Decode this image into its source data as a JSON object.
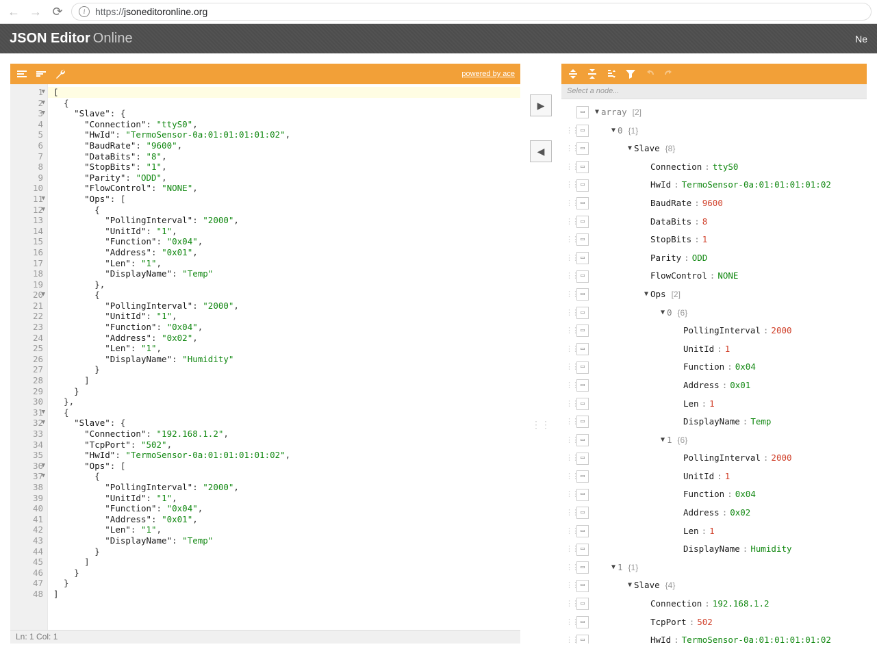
{
  "browser": {
    "url_scheme": "https://",
    "url_domain": "jsoneditoronline.org"
  },
  "header": {
    "logo_bold": "JSON Editor",
    "logo_light": "Online",
    "menu_right": "Ne"
  },
  "left_panel": {
    "powered": "powered by ace",
    "status": "Ln: 1   Col: 1",
    "code_lines": [
      {
        "n": 1,
        "fold": true,
        "tokens": [
          [
            "punc",
            "["
          ]
        ]
      },
      {
        "n": 2,
        "fold": true,
        "tokens": [
          [
            "punc",
            "  {"
          ]
        ]
      },
      {
        "n": 3,
        "fold": true,
        "tokens": [
          [
            "punc",
            "    "
          ],
          [
            "key",
            "\"Slave\""
          ],
          [
            "punc",
            ": {"
          ]
        ]
      },
      {
        "n": 4,
        "tokens": [
          [
            "punc",
            "      "
          ],
          [
            "key",
            "\"Connection\""
          ],
          [
            "punc",
            ": "
          ],
          [
            "str",
            "\"ttyS0\""
          ],
          [
            "punc",
            ","
          ]
        ]
      },
      {
        "n": 5,
        "tokens": [
          [
            "punc",
            "      "
          ],
          [
            "key",
            "\"HwId\""
          ],
          [
            "punc",
            ": "
          ],
          [
            "str",
            "\"TermoSensor-0a:01:01:01:01:02\""
          ],
          [
            "punc",
            ","
          ]
        ]
      },
      {
        "n": 6,
        "tokens": [
          [
            "punc",
            "      "
          ],
          [
            "key",
            "\"BaudRate\""
          ],
          [
            "punc",
            ": "
          ],
          [
            "str",
            "\"9600\""
          ],
          [
            "punc",
            ","
          ]
        ]
      },
      {
        "n": 7,
        "tokens": [
          [
            "punc",
            "      "
          ],
          [
            "key",
            "\"DataBits\""
          ],
          [
            "punc",
            ": "
          ],
          [
            "str",
            "\"8\""
          ],
          [
            "punc",
            ","
          ]
        ]
      },
      {
        "n": 8,
        "tokens": [
          [
            "punc",
            "      "
          ],
          [
            "key",
            "\"StopBits\""
          ],
          [
            "punc",
            ": "
          ],
          [
            "str",
            "\"1\""
          ],
          [
            "punc",
            ","
          ]
        ]
      },
      {
        "n": 9,
        "tokens": [
          [
            "punc",
            "      "
          ],
          [
            "key",
            "\"Parity\""
          ],
          [
            "punc",
            ": "
          ],
          [
            "str",
            "\"ODD\""
          ],
          [
            "punc",
            ","
          ]
        ]
      },
      {
        "n": 10,
        "tokens": [
          [
            "punc",
            "      "
          ],
          [
            "key",
            "\"FlowControl\""
          ],
          [
            "punc",
            ": "
          ],
          [
            "str",
            "\"NONE\""
          ],
          [
            "punc",
            ","
          ]
        ]
      },
      {
        "n": 11,
        "fold": true,
        "tokens": [
          [
            "punc",
            "      "
          ],
          [
            "key",
            "\"Ops\""
          ],
          [
            "punc",
            ": ["
          ]
        ]
      },
      {
        "n": 12,
        "fold": true,
        "tokens": [
          [
            "punc",
            "        {"
          ]
        ]
      },
      {
        "n": 13,
        "tokens": [
          [
            "punc",
            "          "
          ],
          [
            "key",
            "\"PollingInterval\""
          ],
          [
            "punc",
            ": "
          ],
          [
            "str",
            "\"2000\""
          ],
          [
            "punc",
            ","
          ]
        ]
      },
      {
        "n": 14,
        "tokens": [
          [
            "punc",
            "          "
          ],
          [
            "key",
            "\"UnitId\""
          ],
          [
            "punc",
            ": "
          ],
          [
            "str",
            "\"1\""
          ],
          [
            "punc",
            ","
          ]
        ]
      },
      {
        "n": 15,
        "tokens": [
          [
            "punc",
            "          "
          ],
          [
            "key",
            "\"Function\""
          ],
          [
            "punc",
            ": "
          ],
          [
            "str",
            "\"0x04\""
          ],
          [
            "punc",
            ","
          ]
        ]
      },
      {
        "n": 16,
        "tokens": [
          [
            "punc",
            "          "
          ],
          [
            "key",
            "\"Address\""
          ],
          [
            "punc",
            ": "
          ],
          [
            "str",
            "\"0x01\""
          ],
          [
            "punc",
            ","
          ]
        ]
      },
      {
        "n": 17,
        "tokens": [
          [
            "punc",
            "          "
          ],
          [
            "key",
            "\"Len\""
          ],
          [
            "punc",
            ": "
          ],
          [
            "str",
            "\"1\""
          ],
          [
            "punc",
            ","
          ]
        ]
      },
      {
        "n": 18,
        "tokens": [
          [
            "punc",
            "          "
          ],
          [
            "key",
            "\"DisplayName\""
          ],
          [
            "punc",
            ": "
          ],
          [
            "str",
            "\"Temp\""
          ]
        ]
      },
      {
        "n": 19,
        "tokens": [
          [
            "punc",
            "        },"
          ]
        ]
      },
      {
        "n": 20,
        "fold": true,
        "tokens": [
          [
            "punc",
            "        {"
          ]
        ]
      },
      {
        "n": 21,
        "tokens": [
          [
            "punc",
            "          "
          ],
          [
            "key",
            "\"PollingInterval\""
          ],
          [
            "punc",
            ": "
          ],
          [
            "str",
            "\"2000\""
          ],
          [
            "punc",
            ","
          ]
        ]
      },
      {
        "n": 22,
        "tokens": [
          [
            "punc",
            "          "
          ],
          [
            "key",
            "\"UnitId\""
          ],
          [
            "punc",
            ": "
          ],
          [
            "str",
            "\"1\""
          ],
          [
            "punc",
            ","
          ]
        ]
      },
      {
        "n": 23,
        "tokens": [
          [
            "punc",
            "          "
          ],
          [
            "key",
            "\"Function\""
          ],
          [
            "punc",
            ": "
          ],
          [
            "str",
            "\"0x04\""
          ],
          [
            "punc",
            ","
          ]
        ]
      },
      {
        "n": 24,
        "tokens": [
          [
            "punc",
            "          "
          ],
          [
            "key",
            "\"Address\""
          ],
          [
            "punc",
            ": "
          ],
          [
            "str",
            "\"0x02\""
          ],
          [
            "punc",
            ","
          ]
        ]
      },
      {
        "n": 25,
        "tokens": [
          [
            "punc",
            "          "
          ],
          [
            "key",
            "\"Len\""
          ],
          [
            "punc",
            ": "
          ],
          [
            "str",
            "\"1\""
          ],
          [
            "punc",
            ","
          ]
        ]
      },
      {
        "n": 26,
        "tokens": [
          [
            "punc",
            "          "
          ],
          [
            "key",
            "\"DisplayName\""
          ],
          [
            "punc",
            ": "
          ],
          [
            "str",
            "\"Humidity\""
          ]
        ]
      },
      {
        "n": 27,
        "tokens": [
          [
            "punc",
            "        }"
          ]
        ]
      },
      {
        "n": 28,
        "tokens": [
          [
            "punc",
            "      ]"
          ]
        ]
      },
      {
        "n": 29,
        "tokens": [
          [
            "punc",
            "    }"
          ]
        ]
      },
      {
        "n": 30,
        "tokens": [
          [
            "punc",
            "  },"
          ]
        ]
      },
      {
        "n": 31,
        "fold": true,
        "tokens": [
          [
            "punc",
            "  {"
          ]
        ]
      },
      {
        "n": 32,
        "fold": true,
        "tokens": [
          [
            "punc",
            "    "
          ],
          [
            "key",
            "\"Slave\""
          ],
          [
            "punc",
            ": {"
          ]
        ]
      },
      {
        "n": 33,
        "tokens": [
          [
            "punc",
            "      "
          ],
          [
            "key",
            "\"Connection\""
          ],
          [
            "punc",
            ": "
          ],
          [
            "str",
            "\"192.168.1.2\""
          ],
          [
            "punc",
            ","
          ]
        ]
      },
      {
        "n": 34,
        "tokens": [
          [
            "punc",
            "      "
          ],
          [
            "key",
            "\"TcpPort\""
          ],
          [
            "punc",
            ": "
          ],
          [
            "str",
            "\"502\""
          ],
          [
            "punc",
            ","
          ]
        ]
      },
      {
        "n": 35,
        "tokens": [
          [
            "punc",
            "      "
          ],
          [
            "key",
            "\"HwId\""
          ],
          [
            "punc",
            ": "
          ],
          [
            "str",
            "\"TermoSensor-0a:01:01:01:01:02\""
          ],
          [
            "punc",
            ","
          ]
        ]
      },
      {
        "n": 36,
        "fold": true,
        "tokens": [
          [
            "punc",
            "      "
          ],
          [
            "key",
            "\"Ops\""
          ],
          [
            "punc",
            ": ["
          ]
        ]
      },
      {
        "n": 37,
        "fold": true,
        "tokens": [
          [
            "punc",
            "        {"
          ]
        ]
      },
      {
        "n": 38,
        "tokens": [
          [
            "punc",
            "          "
          ],
          [
            "key",
            "\"PollingInterval\""
          ],
          [
            "punc",
            ": "
          ],
          [
            "str",
            "\"2000\""
          ],
          [
            "punc",
            ","
          ]
        ]
      },
      {
        "n": 39,
        "tokens": [
          [
            "punc",
            "          "
          ],
          [
            "key",
            "\"UnitId\""
          ],
          [
            "punc",
            ": "
          ],
          [
            "str",
            "\"1\""
          ],
          [
            "punc",
            ","
          ]
        ]
      },
      {
        "n": 40,
        "tokens": [
          [
            "punc",
            "          "
          ],
          [
            "key",
            "\"Function\""
          ],
          [
            "punc",
            ": "
          ],
          [
            "str",
            "\"0x04\""
          ],
          [
            "punc",
            ","
          ]
        ]
      },
      {
        "n": 41,
        "tokens": [
          [
            "punc",
            "          "
          ],
          [
            "key",
            "\"Address\""
          ],
          [
            "punc",
            ": "
          ],
          [
            "str",
            "\"0x01\""
          ],
          [
            "punc",
            ","
          ]
        ]
      },
      {
        "n": 42,
        "tokens": [
          [
            "punc",
            "          "
          ],
          [
            "key",
            "\"Len\""
          ],
          [
            "punc",
            ": "
          ],
          [
            "str",
            "\"1\""
          ],
          [
            "punc",
            ","
          ]
        ]
      },
      {
        "n": 43,
        "tokens": [
          [
            "punc",
            "          "
          ],
          [
            "key",
            "\"DisplayName\""
          ],
          [
            "punc",
            ": "
          ],
          [
            "str",
            "\"Temp\""
          ]
        ]
      },
      {
        "n": 44,
        "tokens": [
          [
            "punc",
            "        }"
          ]
        ]
      },
      {
        "n": 45,
        "tokens": [
          [
            "punc",
            "      ]"
          ]
        ]
      },
      {
        "n": 46,
        "tokens": [
          [
            "punc",
            "    }"
          ]
        ]
      },
      {
        "n": 47,
        "tokens": [
          [
            "punc",
            "  }"
          ]
        ]
      },
      {
        "n": 48,
        "tokens": [
          [
            "punc",
            "]"
          ]
        ]
      }
    ]
  },
  "middle": {
    "arrow_right": "▶",
    "arrow_left": "◀"
  },
  "right_panel": {
    "node_path_placeholder": "Select a node...",
    "tree_rows": [
      {
        "indent": 0,
        "nohandle": true,
        "caret": "▼",
        "key": "array",
        "count": "[2]",
        "keyGray": true
      },
      {
        "indent": 1,
        "caret": "▼",
        "key": "0",
        "count": "{1}",
        "keyGray": true
      },
      {
        "indent": 2,
        "caret": "▼",
        "key": "Slave",
        "count": "{8}"
      },
      {
        "indent": 3,
        "key": "Connection",
        "sep": ":",
        "val": "ttyS0",
        "vtype": "str"
      },
      {
        "indent": 3,
        "key": "HwId",
        "sep": ":",
        "val": "TermoSensor-0a:01:01:01:01:02",
        "vtype": "str"
      },
      {
        "indent": 3,
        "key": "BaudRate",
        "sep": ":",
        "val": "9600",
        "vtype": "num"
      },
      {
        "indent": 3,
        "key": "DataBits",
        "sep": ":",
        "val": "8",
        "vtype": "num"
      },
      {
        "indent": 3,
        "key": "StopBits",
        "sep": ":",
        "val": "1",
        "vtype": "num"
      },
      {
        "indent": 3,
        "key": "Parity",
        "sep": ":",
        "val": "ODD",
        "vtype": "str"
      },
      {
        "indent": 3,
        "key": "FlowControl",
        "sep": ":",
        "val": "NONE",
        "vtype": "str"
      },
      {
        "indent": 3,
        "caret": "▼",
        "key": "Ops",
        "count": "[2]"
      },
      {
        "indent": 4,
        "caret": "▼",
        "key": "0",
        "count": "{6}",
        "keyGray": true
      },
      {
        "indent": 5,
        "key": "PollingInterval",
        "sep": ":",
        "val": "2000",
        "vtype": "num"
      },
      {
        "indent": 5,
        "key": "UnitId",
        "sep": ":",
        "val": "1",
        "vtype": "num"
      },
      {
        "indent": 5,
        "key": "Function",
        "sep": ":",
        "val": "0x04",
        "vtype": "str"
      },
      {
        "indent": 5,
        "key": "Address",
        "sep": ":",
        "val": "0x01",
        "vtype": "str"
      },
      {
        "indent": 5,
        "key": "Len ",
        "sep": ":",
        "val": "1",
        "vtype": "num"
      },
      {
        "indent": 5,
        "key": "DisplayName",
        "sep": ":",
        "val": "Temp",
        "vtype": "str"
      },
      {
        "indent": 4,
        "caret": "▼",
        "key": "1",
        "count": "{6}",
        "keyGray": true
      },
      {
        "indent": 5,
        "key": "PollingInterval",
        "sep": ":",
        "val": "2000",
        "vtype": "num"
      },
      {
        "indent": 5,
        "key": "UnitId",
        "sep": ":",
        "val": "1",
        "vtype": "num"
      },
      {
        "indent": 5,
        "key": "Function",
        "sep": ":",
        "val": "0x04",
        "vtype": "str"
      },
      {
        "indent": 5,
        "key": "Address",
        "sep": ":",
        "val": "0x02",
        "vtype": "str"
      },
      {
        "indent": 5,
        "key": "Len ",
        "sep": ":",
        "val": "1",
        "vtype": "num"
      },
      {
        "indent": 5,
        "key": "DisplayName",
        "sep": ":",
        "val": "Humidity",
        "vtype": "str"
      },
      {
        "indent": 1,
        "caret": "▼",
        "key": "1",
        "count": "{1}",
        "keyGray": true
      },
      {
        "indent": 2,
        "caret": "▼",
        "key": "Slave",
        "count": "{4}"
      },
      {
        "indent": 3,
        "key": "Connection",
        "sep": ":",
        "val": "192.168.1.2",
        "vtype": "str"
      },
      {
        "indent": 3,
        "key": "TcpPort",
        "sep": ":",
        "val": "502",
        "vtype": "num"
      },
      {
        "indent": 3,
        "key": "HwId",
        "sep": ":",
        "val": "TermoSensor-0a:01:01:01:01:02",
        "vtype": "str"
      }
    ]
  }
}
